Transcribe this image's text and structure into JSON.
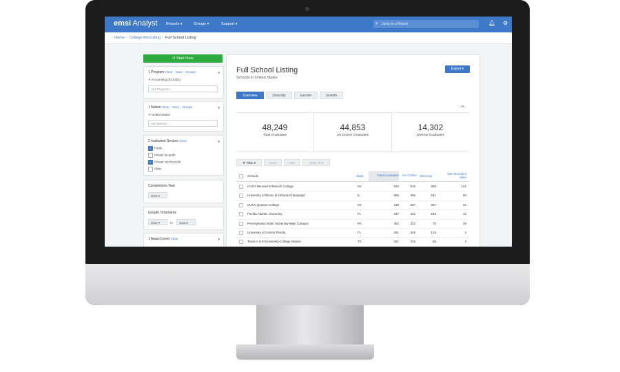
{
  "topbar": {
    "brand_a": "emsi",
    "brand_b": "Analyst",
    "nav": [
      "Reports ▾",
      "Groups ▾",
      "Support ▾"
    ],
    "search_placeholder": "Jump to a Report",
    "icons": [
      "search-icon",
      "bell-icon",
      "gear-icon"
    ]
  },
  "breadcrumb": [
    "Home",
    "›",
    "College Recruiting",
    "›",
    "Full School Listing"
  ],
  "sidebar": {
    "start_over": "↺ Start Over",
    "program": {
      "label": "1 Program",
      "clear": "Clear",
      "save": "Save",
      "groups": "Groups",
      "sep": "·",
      "chip": "✕ Accounting (52.0301)",
      "placeholder": "Add Programs..."
    },
    "nation": {
      "label": "1 Nation",
      "clear": "Clear",
      "save": "Save",
      "groups": "Groups",
      "sep": "·",
      "chip": "✕ United States",
      "placeholder": "Add Nations..."
    },
    "sectors": {
      "label": "2 Institution Sectors",
      "clear": "Clear",
      "options": [
        "Public",
        "Private for-profit",
        "Private not-for-profit",
        "Other"
      ],
      "checked": [
        true,
        false,
        true,
        false
      ]
    },
    "completions": {
      "label": "Completions Year",
      "value": "2013"
    },
    "growth": {
      "label": "Growth Timeframe",
      "from": "2012",
      "to_label": "to",
      "to": "2013"
    },
    "award": {
      "label": "1 Award Level",
      "clear": "Clear"
    }
  },
  "main": {
    "title": "Full School Listing",
    "subtitle": "Schools in United States",
    "export": "Export ▾",
    "tabs": [
      "Overview",
      "Diversity",
      "Gender",
      "Growth"
    ],
    "active_tab": "Overview",
    "stats": [
      {
        "value": "48,249",
        "label": "Total Graduates"
      },
      {
        "value": "44,853",
        "label": "US Citizen Graduates"
      },
      {
        "value": "14,302",
        "label": "Diverse Graduates"
      }
    ],
    "toolbar": [
      "▼ Filter ▾",
      "Keep",
      "Hide",
      "Jump To ▾"
    ],
    "table": {
      "headers": [
        "Schools",
        "State",
        "Total Graduates",
        "US Citizen",
        "Diversity",
        "Non-Resident Alien"
      ],
      "rows": [
        [
          "CUNY Bernard M Baruch College",
          "NY",
          "620",
          "519",
          "369",
          "101"
        ],
        [
          "University of Illinois at Urbana-Champaign",
          "IL",
          "555",
          "465",
          "241",
          "90"
        ],
        [
          "CUNY Queens College",
          "NY",
          "438",
          "407",
          "267",
          "31"
        ],
        [
          "Florida Atlantic University",
          "FL",
          "437",
          "422",
          "215",
          "15"
        ],
        [
          "Pennsylvania State University-Main Campus",
          "PA",
          "362",
          "323",
          "70",
          "39"
        ],
        [
          "University of Central Florida",
          "FL",
          "351",
          "349",
          "124",
          "2"
        ],
        [
          "Texas A & M University-College Station",
          "TX",
          "321",
          "318",
          "65",
          "3"
        ]
      ]
    }
  }
}
